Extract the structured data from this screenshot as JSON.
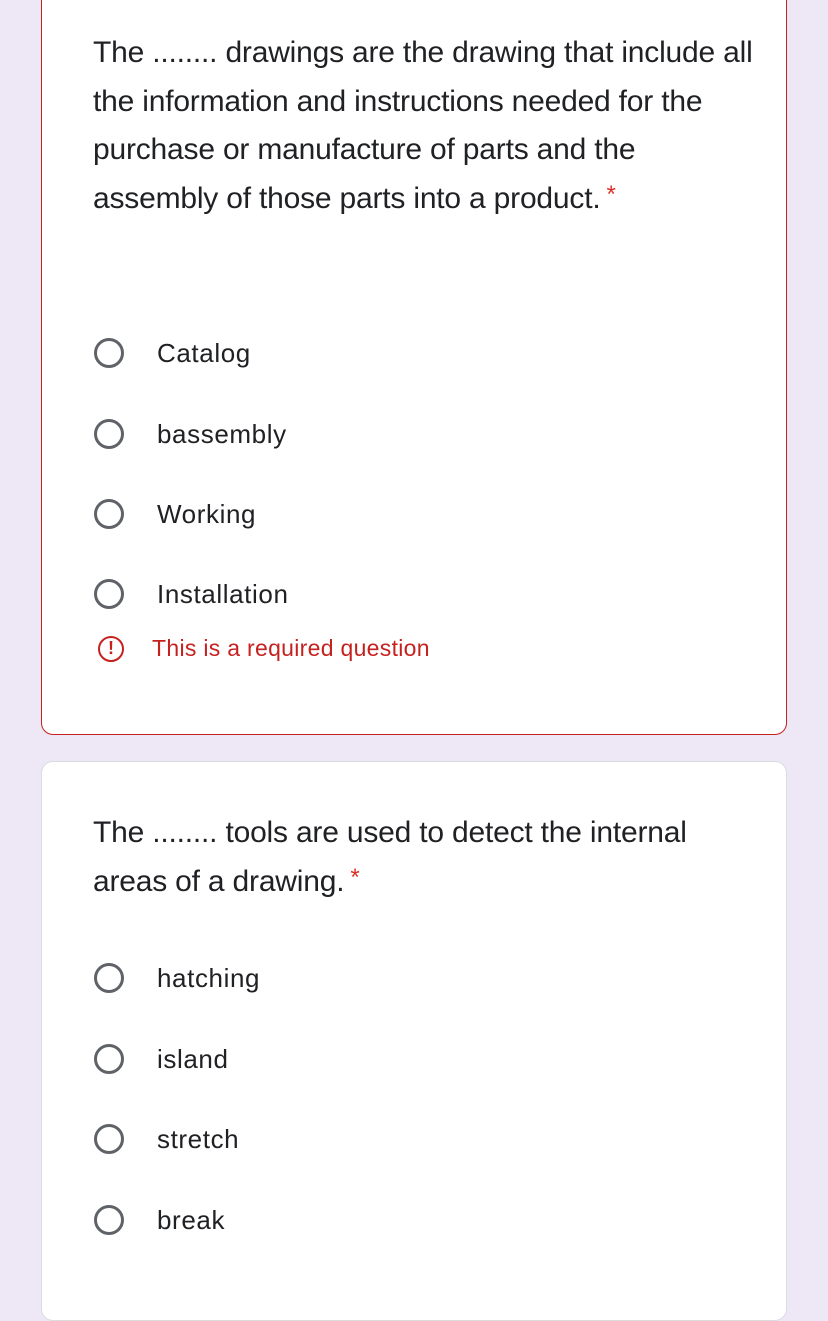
{
  "questions": [
    {
      "text": "The ........ drawings are the drawing that include all the information and instructions needed for the purchase or manufacture of parts and the assembly of those parts into a product.",
      "required_marker": "*",
      "options": [
        {
          "label": "Catalog",
          "selected": false
        },
        {
          "label": "bassembly",
          "selected": false
        },
        {
          "label": "Working",
          "selected": false
        },
        {
          "label": "Installation",
          "selected": false
        }
      ],
      "error": {
        "icon": "alert-circle-icon",
        "icon_glyph": "!",
        "message": "This is a required question"
      }
    },
    {
      "text": "The ........ tools are used to detect the internal areas of a drawing.",
      "required_marker": "*",
      "options": [
        {
          "label": "hatching",
          "selected": false
        },
        {
          "label": "island",
          "selected": false
        },
        {
          "label": "stretch",
          "selected": false
        },
        {
          "label": "break",
          "selected": false
        }
      ]
    }
  ],
  "colors": {
    "page_background": "#ede7f6",
    "error": "#c5221f",
    "required_star": "#d93025",
    "text": "#202124",
    "radio_border": "#5f6368"
  }
}
